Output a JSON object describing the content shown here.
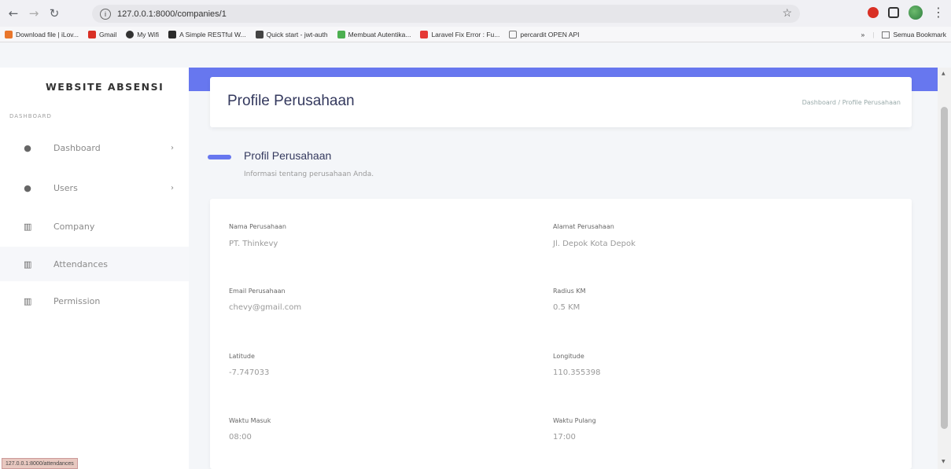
{
  "browser": {
    "url": "127.0.0.1:8000/companies/1",
    "info_icon": "i",
    "bookmarks": [
      {
        "label": "Download file | iLov...",
        "color": "#e9762b"
      },
      {
        "label": "Gmail",
        "color": "#d93025"
      },
      {
        "label": "My Wifi",
        "color": "#333333"
      },
      {
        "label": "A Simple RESTful W...",
        "color": "#2b2b2b"
      },
      {
        "label": "Quick start - jwt-auth",
        "color": "#444444"
      },
      {
        "label": "Membuat Autentika...",
        "color": "#4caf50"
      },
      {
        "label": "Laravel Fix Error : Fu...",
        "color": "#e53935"
      },
      {
        "label": "percardit OPEN API",
        "color": "#777777"
      }
    ],
    "bookmarks_overflow": "»",
    "all_bookmarks": "Semua Bookmark",
    "status_url": "127.0.0.1:8000/attendances"
  },
  "sidebar": {
    "brand": "WEBSITE ABSENSI",
    "section_label": "DASHBOARD",
    "items": [
      {
        "label": "Dashboard",
        "icon": "circle-icon",
        "chevron": "›"
      },
      {
        "label": "Users",
        "icon": "circle-icon",
        "chevron": "›"
      },
      {
        "label": "Company",
        "icon": "grid-icon",
        "chevron": ""
      },
      {
        "label": "Attendances",
        "icon": "grid-icon",
        "chevron": ""
      },
      {
        "label": "Permission",
        "icon": "grid-icon",
        "chevron": ""
      }
    ]
  },
  "header": {
    "title": "Profile Perusahaan",
    "breadcrumb": "Dashboard / Profile Perusahaan"
  },
  "section": {
    "title": "Profil Perusahaan",
    "subtitle": "Informasi tentang perusahaan Anda."
  },
  "fields": {
    "nama": {
      "label": "Nama Perusahaan",
      "value": "PT. Thinkevy"
    },
    "alamat": {
      "label": "Alamat Perusahaan",
      "value": "Jl. Depok Kota Depok"
    },
    "email": {
      "label": "Email Perusahaan",
      "value": "chevy@gmail.com"
    },
    "radius": {
      "label": "Radius KM",
      "value": "0.5 KM"
    },
    "latitude": {
      "label": "Latitude",
      "value": "-7.747033"
    },
    "longitude": {
      "label": "Longitude",
      "value": "110.355398"
    },
    "masuk": {
      "label": "Waktu Masuk",
      "value": "08:00"
    },
    "pulang": {
      "label": "Waktu Pulang",
      "value": "17:00"
    }
  },
  "colors": {
    "accent": "#6777ef"
  }
}
